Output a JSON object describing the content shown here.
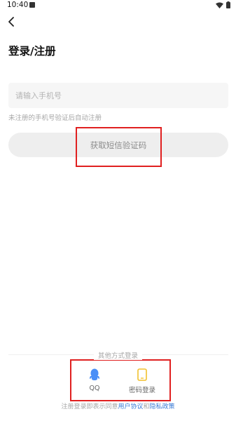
{
  "status_bar": {
    "time": "10:40"
  },
  "page": {
    "title": "登录/注册"
  },
  "phone": {
    "placeholder": "请输入手机号"
  },
  "hint": "未注册的手机号验证后自动注册",
  "sms_button_label": "获取短信验证码",
  "other_login": {
    "label": "其他方式登录",
    "options": [
      {
        "label": "QQ",
        "icon": "qq-icon",
        "color": "#4a8ff7"
      },
      {
        "label": "密码登录",
        "icon": "tablet-icon",
        "color": "#f2c12e"
      }
    ]
  },
  "terms": {
    "prefix": "注册登录即表示同意",
    "user_agreement": "用户协议",
    "conjunction": "和",
    "privacy_policy": "隐私政策"
  },
  "colors": {
    "link": "#3a7bd5",
    "highlight": "#e02020"
  }
}
